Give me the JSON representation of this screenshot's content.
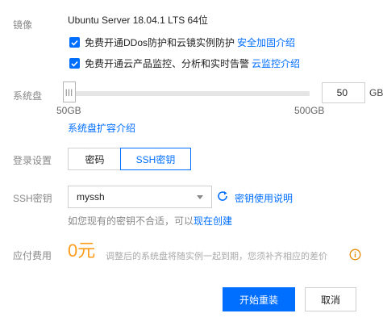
{
  "image": {
    "label": "镜像",
    "value": "Ubuntu Server 18.04.1 LTS 64位"
  },
  "options": [
    {
      "text": "免费开通DDos防护和云镜实例防护",
      "link": "安全加固介绍",
      "checked": true
    },
    {
      "text": "免费开通云产品监控、分析和实时告警",
      "link": "云监控介绍",
      "checked": true
    }
  ],
  "disk": {
    "label": "系统盘",
    "value": "50",
    "unit": "GB",
    "min_label": "50GB",
    "max_label": "500GB",
    "fill_fraction": 0,
    "link": "系统盘扩容介绍"
  },
  "login": {
    "label": "登录设置",
    "tabs": [
      "密码",
      "SSH密钥"
    ],
    "active": "SSH密钥"
  },
  "ssh": {
    "label": "SSH密钥",
    "selected": "myssh",
    "link": "密钥使用说明",
    "hint_prefix": "如您现有的密钥不合适，可以",
    "hint_link": "现在创建"
  },
  "fee": {
    "label": "应付费用",
    "amount": "0元",
    "note": "调整后的系统盘将随实例一起到期，您须补齐相应的差价"
  },
  "actions": {
    "primary": "开始重装",
    "cancel": "取消"
  },
  "colors": {
    "accent": "#006eff",
    "amount": "#ff9c19",
    "info": "#e38a00"
  }
}
